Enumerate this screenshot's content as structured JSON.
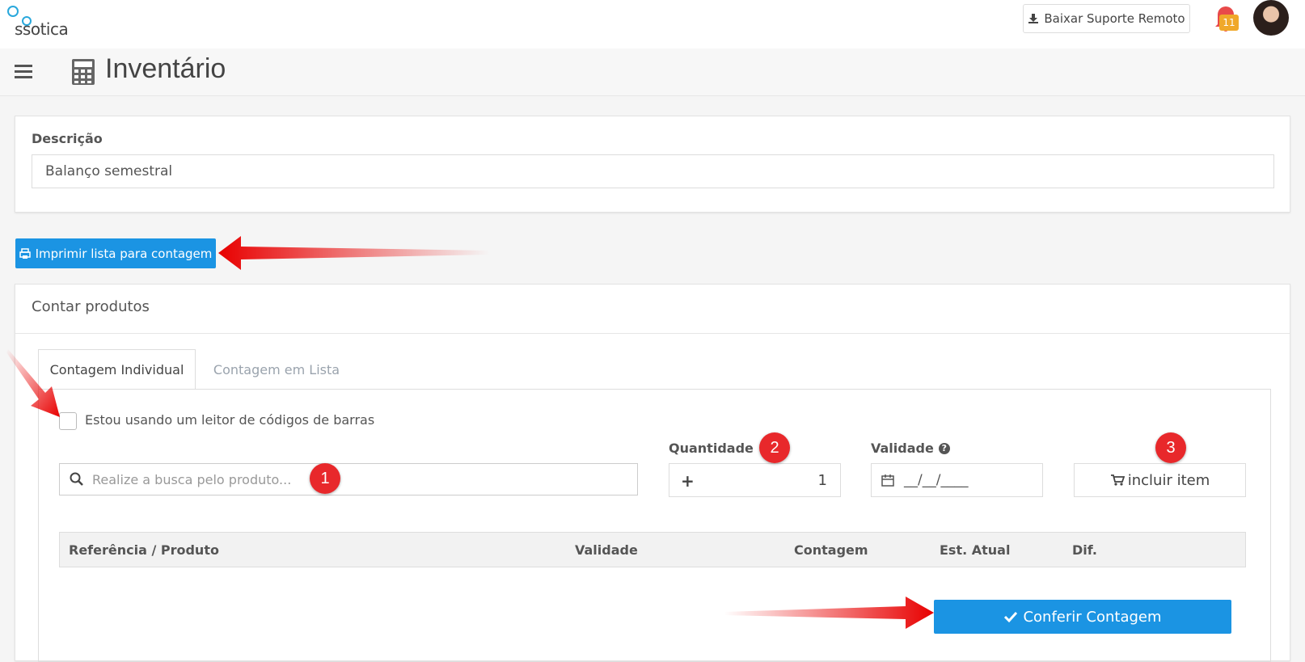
{
  "topbar": {
    "logo_text": "ssotica",
    "suporte_label": "Baixar Suporte Remoto",
    "notif_count": "11"
  },
  "header": {
    "title": "Inventário"
  },
  "descricao": {
    "label": "Descrição",
    "value": "Balanço semestral"
  },
  "print_button": "Imprimir lista para contagem",
  "contar": {
    "title": "Contar produtos",
    "tabs": [
      {
        "label": "Contagem Individual",
        "active": true
      },
      {
        "label": "Contagem em Lista",
        "active": false
      }
    ],
    "barcode_label": "Estou usando um leitor de códigos de barras",
    "search_placeholder": "Realize a busca pelo produto...",
    "qty_label": "Quantidade",
    "qty_value": "1",
    "validade_label": "Validade",
    "validade_value": "__/__/____",
    "incluir_label": "incluir item",
    "table_headers": [
      "Referência / Produto",
      "Validade",
      "Contagem",
      "Est. Atual",
      "Dif."
    ],
    "conferir_label": "Conferir Contagem"
  },
  "annotations": [
    "1",
    "2",
    "3"
  ],
  "colors": {
    "primary": "#1b94e3",
    "badge_red": "#e8282b",
    "notif": "#f0a82a"
  }
}
